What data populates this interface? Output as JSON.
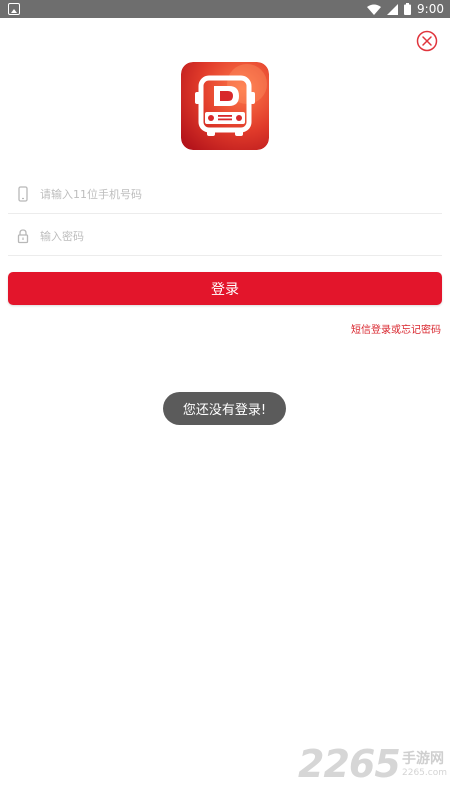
{
  "status_bar": {
    "time": "9:00",
    "icons": [
      "notification-icon",
      "wifi-icon",
      "cell-signal-icon",
      "battery-icon"
    ]
  },
  "close_icon": "close-circle-icon",
  "app_logo": {
    "icon": "bus-app-logo",
    "accent": "#d8282b"
  },
  "phone_field": {
    "icon": "phone-icon",
    "value": "",
    "placeholder": "请输入11位手机号码"
  },
  "password_field": {
    "icon": "lock-icon",
    "value": "",
    "placeholder": "输入密码"
  },
  "login_button": {
    "label": "登录",
    "color": "#e3152b"
  },
  "sms_link": {
    "label": "短信登录或忘记密码",
    "color": "#d9262e"
  },
  "toast": {
    "text": "您还没有登录!"
  },
  "watermark": {
    "number": "2265",
    "text": "手游网",
    "url": "2265.com"
  }
}
